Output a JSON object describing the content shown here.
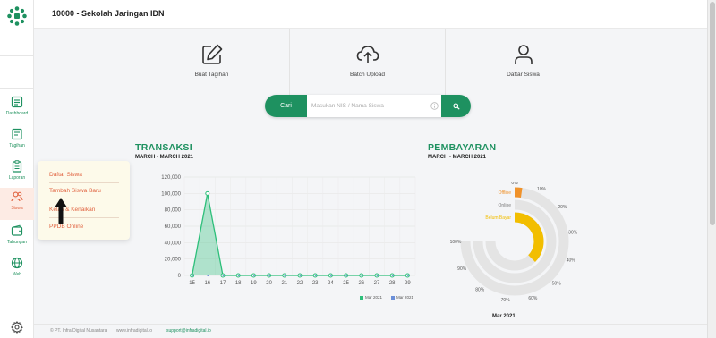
{
  "header": {
    "title": "10000 - Sekolah Jaringan IDN"
  },
  "sidebar": {
    "items": [
      {
        "label": "Dashboard",
        "icon": "dashboard-icon"
      },
      {
        "label": "Tagihan",
        "icon": "invoice-icon"
      },
      {
        "label": "Laporan",
        "icon": "report-clipboard-icon"
      },
      {
        "label": "Siswa",
        "icon": "students-icon"
      },
      {
        "label": "Tabungan",
        "icon": "wallet-icon"
      },
      {
        "label": "Web",
        "icon": "globe-icon"
      }
    ]
  },
  "actions": [
    {
      "label": "Buat Tagihan",
      "icon": "edit-icon"
    },
    {
      "label": "Batch Upload",
      "icon": "cloud-upload-icon"
    },
    {
      "label": "Daftar Siswa",
      "icon": "user-icon"
    }
  ],
  "search": {
    "button_label": "Cari",
    "placeholder": "Masukan NIS / Nama Siswa",
    "value": ""
  },
  "transaksi": {
    "title": "TRANSAKSI",
    "subtitle": "MARCH - MARCH 2021"
  },
  "pembayaran": {
    "title": "PEMBAYARAN",
    "subtitle": "MARCH - MARCH 2021",
    "caption": "Mar 2021"
  },
  "dropdown": {
    "items": [
      "Daftar Siswa",
      "Tambah Siswa Baru",
      "Kelas & Kenaikan",
      "PPDB Online"
    ]
  },
  "footer": {
    "copyright": "© PT. Infra Digital Nusantara",
    "website": "www.infradigital.io",
    "email": "support@infradigital.io"
  },
  "colors": {
    "brand": "#1e9160",
    "accent": "#e0623f",
    "gold": "#f2be00",
    "series2": "#6b8fd8"
  },
  "chart_data": [
    {
      "type": "area",
      "title": "TRANSAKSI",
      "categories": [
        "15",
        "16",
        "17",
        "18",
        "19",
        "20",
        "21",
        "22",
        "23",
        "24",
        "25",
        "26",
        "27",
        "28",
        "29"
      ],
      "series": [
        {
          "name": "Mar 2021",
          "values": [
            0,
            100000,
            0,
            0,
            0,
            0,
            0,
            0,
            0,
            0,
            0,
            0,
            0,
            0,
            0
          ]
        },
        {
          "name": "Mar 2021",
          "values": [
            0,
            0,
            0,
            0,
            0,
            0,
            0,
            0,
            0,
            0,
            0,
            0,
            0,
            0,
            0
          ]
        }
      ],
      "ylim": [
        0,
        120000
      ],
      "yticks": [
        "0",
        "20,000",
        "40,000",
        "60,000",
        "80,000",
        "100,000",
        "120,000"
      ],
      "grid": true,
      "legend": "bottom-right"
    },
    {
      "type": "radial-bar",
      "title": "PEMBAYARAN",
      "categories": [
        "Offline",
        "Online",
        "Belum Bayar"
      ],
      "values": [
        3,
        0,
        50
      ],
      "ticks": [
        "0%",
        "10%",
        "20%",
        "30%",
        "40%",
        "50%",
        "60%",
        "70%",
        "80%",
        "90%",
        "100%"
      ],
      "caption": "Mar 2021"
    }
  ]
}
